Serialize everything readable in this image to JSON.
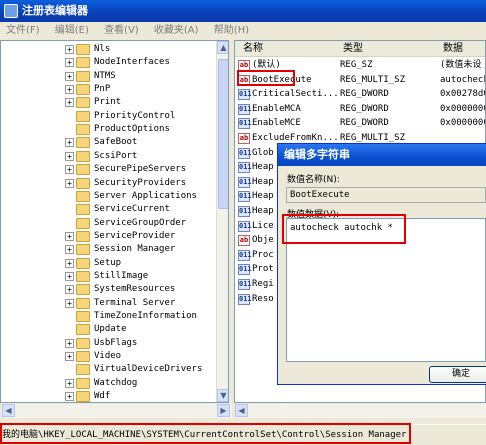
{
  "window": {
    "title": "注册表编辑器"
  },
  "menu": [
    "文件(F)",
    "编辑(E)",
    "查看(V)",
    "收藏夹(A)",
    "帮助(H)"
  ],
  "tree": {
    "items": [
      {
        "label": "Nls",
        "expandable": true
      },
      {
        "label": "NodeInterfaces",
        "expandable": true
      },
      {
        "label": "NTMS",
        "expandable": true
      },
      {
        "label": "PnP",
        "expandable": true
      },
      {
        "label": "Print",
        "expandable": true
      },
      {
        "label": "PriorityControl",
        "expandable": false
      },
      {
        "label": "ProductOptions",
        "expandable": false
      },
      {
        "label": "SafeBoot",
        "expandable": true
      },
      {
        "label": "ScsiPort",
        "expandable": true
      },
      {
        "label": "SecurePipeServers",
        "expandable": true
      },
      {
        "label": "SecurityProviders",
        "expandable": true
      },
      {
        "label": "Server Applications",
        "expandable": false
      },
      {
        "label": "ServiceCurrent",
        "expandable": false
      },
      {
        "label": "ServiceGroupOrder",
        "expandable": false
      },
      {
        "label": "ServiceProvider",
        "expandable": true
      },
      {
        "label": "Session Manager",
        "expandable": true
      },
      {
        "label": "Setup",
        "expandable": true
      },
      {
        "label": "StillImage",
        "expandable": true
      },
      {
        "label": "SystemResources",
        "expandable": true
      },
      {
        "label": "Terminal Server",
        "expandable": true
      },
      {
        "label": "TimeZoneInformation",
        "expandable": false
      },
      {
        "label": "Update",
        "expandable": false
      },
      {
        "label": "UsbFlags",
        "expandable": true
      },
      {
        "label": "Video",
        "expandable": true
      },
      {
        "label": "VirtualDeviceDrivers",
        "expandable": false
      },
      {
        "label": "Watchdog",
        "expandable": true
      },
      {
        "label": "Wdf",
        "expandable": true
      }
    ]
  },
  "list": {
    "columns": {
      "name": "名称",
      "type": "类型",
      "data": "数据"
    },
    "rows": [
      {
        "icon": "ab",
        "name": "(默认)",
        "type": "REG_SZ",
        "data": "(数值未设"
      },
      {
        "icon": "ab",
        "name": "BootExecute",
        "type": "REG_MULTI_SZ",
        "data": "autocheck"
      },
      {
        "icon": "bin",
        "name": "CriticalSecti...",
        "type": "REG_DWORD",
        "data": "0x00278d0"
      },
      {
        "icon": "bin",
        "name": "EnableMCA",
        "type": "REG_DWORD",
        "data": "0x0000000"
      },
      {
        "icon": "bin",
        "name": "EnableMCE",
        "type": "REG_DWORD",
        "data": "0x0000000"
      },
      {
        "icon": "ab",
        "name": "ExcludeFromKn...",
        "type": "REG_MULTI_SZ",
        "data": ""
      },
      {
        "icon": "bin",
        "name": "Glob",
        "type": "",
        "data": ""
      },
      {
        "icon": "bin",
        "name": "Heap",
        "type": "",
        "data": ""
      },
      {
        "icon": "bin",
        "name": "Heap",
        "type": "",
        "data": ""
      },
      {
        "icon": "bin",
        "name": "Heap",
        "type": "",
        "data": ""
      },
      {
        "icon": "bin",
        "name": "Heap",
        "type": "",
        "data": ""
      },
      {
        "icon": "bin",
        "name": "Lice",
        "type": "",
        "data": ""
      },
      {
        "icon": "ab",
        "name": "Obje",
        "type": "",
        "data": ""
      },
      {
        "icon": "bin",
        "name": "Proc",
        "type": "",
        "data": ""
      },
      {
        "icon": "bin",
        "name": "Prot",
        "type": "",
        "data": ""
      },
      {
        "icon": "bin",
        "name": "Regi",
        "type": "",
        "data": ""
      },
      {
        "icon": "bin",
        "name": "Reso",
        "type": "",
        "data": ""
      }
    ]
  },
  "dialog": {
    "title": "编辑多字符串",
    "name_label": "数值名称(N):",
    "name_value": "BootExecute",
    "data_label": "数值数据(V):",
    "data_value": "autocheck autochk *",
    "ok_label": "确定"
  },
  "status": {
    "path": "我的电脑\\HKEY_LOCAL_MACHINE\\SYSTEM\\CurrentControlSet\\Control\\Session Manager"
  },
  "colors": {
    "highlight": "#e00000",
    "titlebar": "#0b4fd0"
  }
}
